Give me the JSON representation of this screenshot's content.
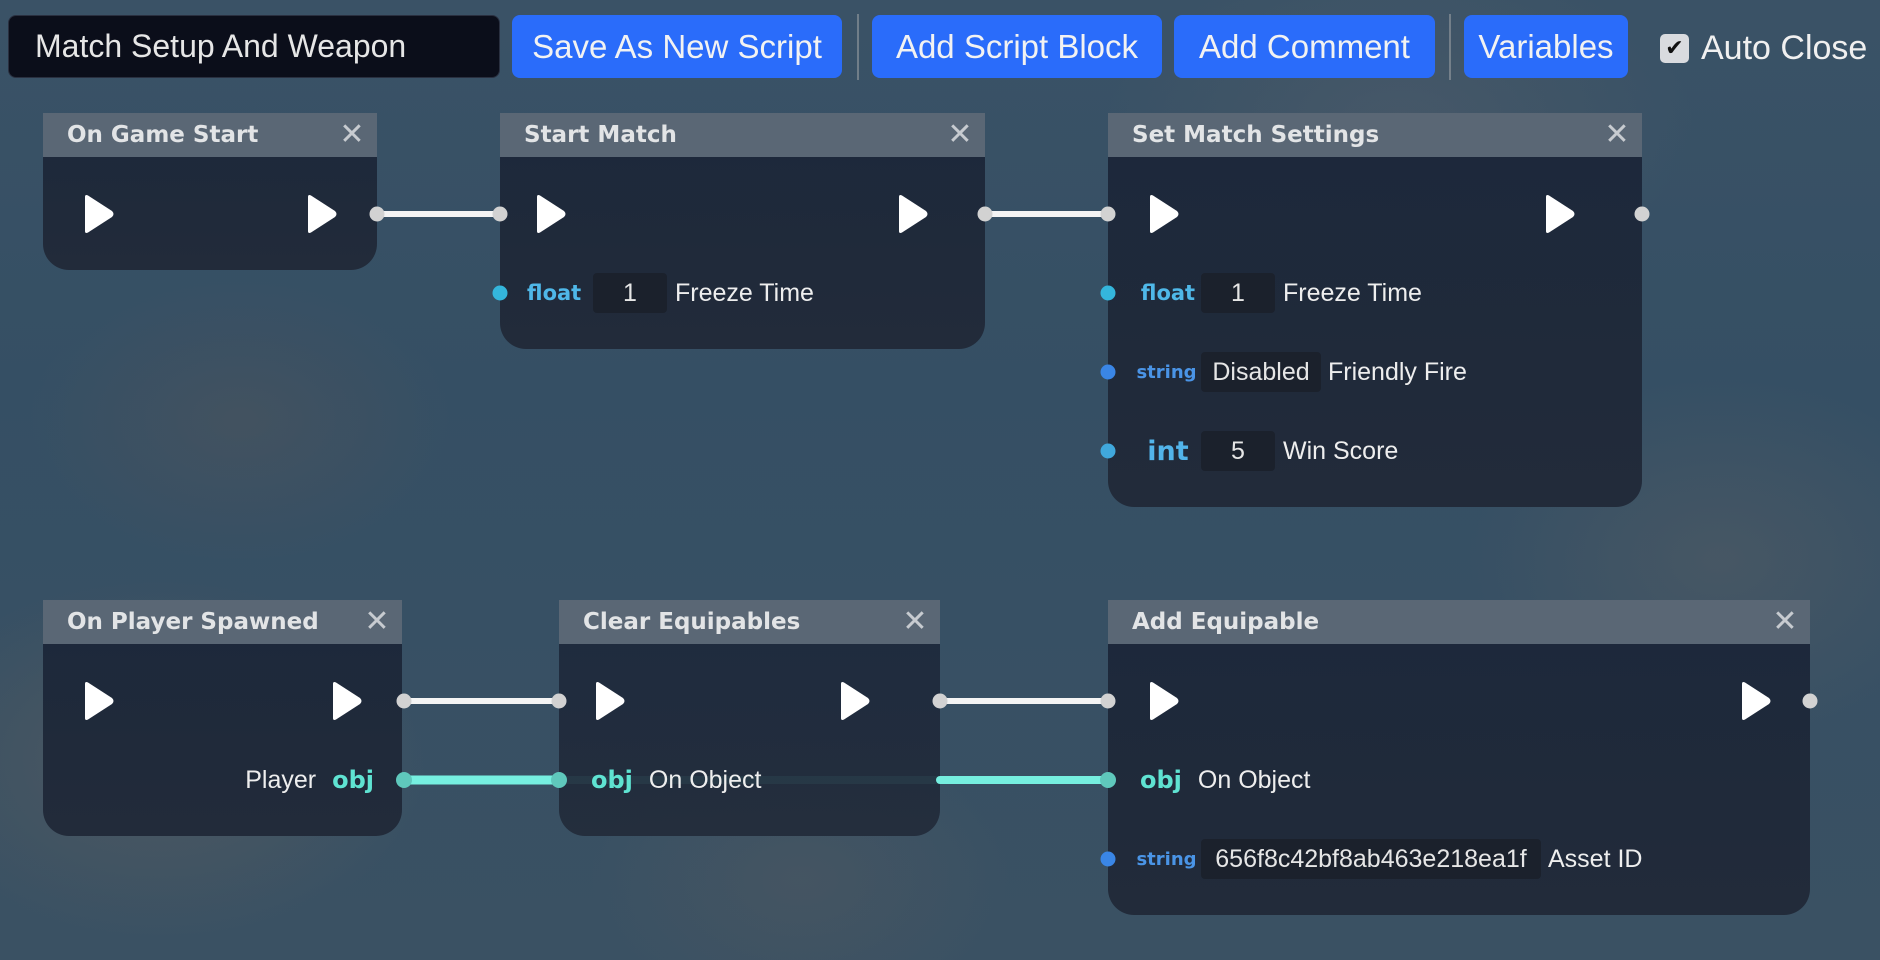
{
  "toolbar": {
    "script_name": "Match Setup And Weapon",
    "save_as_new_label": "Save As New Script",
    "add_block_label": "Add Script Block",
    "add_comment_label": "Add Comment",
    "variables_label": "Variables",
    "auto_close_label": "Auto Close",
    "auto_close_checked": true,
    "checkmark": "✔"
  },
  "colors": {
    "button_blue": "#2a6cfa",
    "exec_wire": "#ffffff",
    "obj_wire": "#76efe0",
    "float_type": "#4fb8e8",
    "string_type": "#4a94e6",
    "int_type": "#52b4ea",
    "obj_type": "#5fe3d2"
  },
  "close_glyph": "✕",
  "nodes": {
    "on_game_start": {
      "title": "On Game Start"
    },
    "start_match": {
      "title": "Start Match",
      "params": [
        {
          "type": "float",
          "value": "1",
          "label": "Freeze Time"
        }
      ]
    },
    "set_match_settings": {
      "title": "Set Match Settings",
      "params": [
        {
          "type": "float",
          "value": "1",
          "label": "Freeze Time"
        },
        {
          "type": "string",
          "value": "Disabled",
          "label": "Friendly Fire"
        },
        {
          "type": "int",
          "value": "5",
          "label": "Win Score"
        }
      ]
    },
    "on_player_spawned": {
      "title": "On Player Spawned",
      "outputs": [
        {
          "type": "obj",
          "label": "Player"
        }
      ]
    },
    "clear_equipables": {
      "title": "Clear Equipables",
      "params": [
        {
          "type": "obj",
          "label": "On Object"
        }
      ]
    },
    "add_equipable": {
      "title": "Add Equipable",
      "params": [
        {
          "type": "obj",
          "label": "On Object"
        },
        {
          "type": "string",
          "value": "656f8c42bf8ab463e218ea1f",
          "label": "Asset ID"
        }
      ]
    }
  },
  "connections": [
    {
      "from": "On Game Start.exec-out",
      "to": "Start Match.exec-in",
      "kind": "exec"
    },
    {
      "from": "Start Match.exec-out",
      "to": "Set Match Settings.exec-in",
      "kind": "exec"
    },
    {
      "from": "On Player Spawned.exec-out",
      "to": "Clear Equipables.exec-in",
      "kind": "exec"
    },
    {
      "from": "Clear Equipables.exec-out",
      "to": "Add Equipable.exec-in",
      "kind": "exec"
    },
    {
      "from": "On Player Spawned.Player",
      "to": "Clear Equipables.On Object",
      "kind": "obj"
    },
    {
      "from": "On Player Spawned.Player",
      "to": "Add Equipable.On Object",
      "kind": "obj"
    }
  ]
}
